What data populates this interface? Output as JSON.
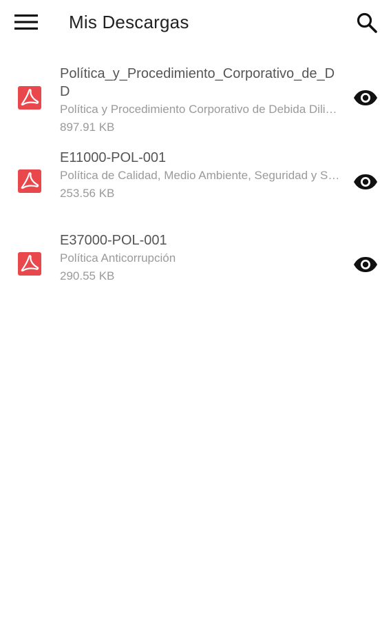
{
  "header": {
    "title": "Mis Descargas",
    "menu_icon": "hamburger-menu-icon",
    "search_icon": "search-icon"
  },
  "downloads": [
    {
      "name": "Política_y_Procedimiento_Corporativo_de_DD",
      "description": "Política y Procedimiento Corporativo de Debida Diligencia",
      "size": "897.91 KB",
      "file_icon": "pdf-file-icon",
      "action_icon": "eye-view-icon"
    },
    {
      "name": "E11000-POL-001",
      "description": "Política de Calidad, Medio Ambiente, Seguridad y Salud",
      "size": "253.56 KB",
      "file_icon": "pdf-file-icon",
      "action_icon": "eye-view-icon"
    },
    {
      "name": "E37000-POL-001",
      "description": "Política Anticorrupción",
      "size": "290.55 KB",
      "file_icon": "pdf-file-icon",
      "action_icon": "eye-view-icon"
    }
  ],
  "colors": {
    "pdf_red": "#e8474b",
    "title_text": "#222222",
    "name_text": "#555555",
    "secondary_text": "#9a9a9a",
    "icon_dark": "#111111"
  }
}
